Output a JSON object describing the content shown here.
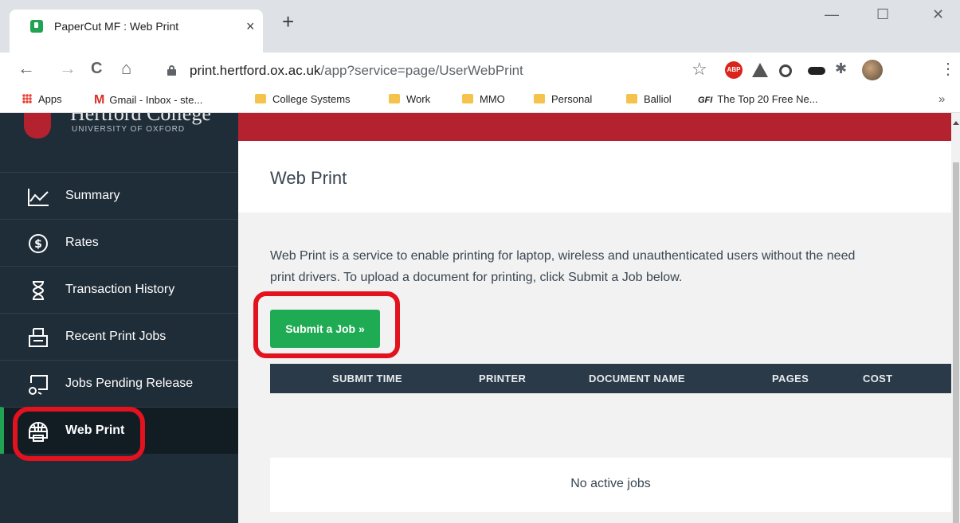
{
  "browser": {
    "tab_title": "PaperCut MF : Web Print",
    "tab_close": "×",
    "new_tab": "+",
    "window_controls": {
      "minimize": "—",
      "maximize": "☐",
      "close": "✕"
    },
    "nav": {
      "back": "←",
      "forward": "→",
      "reload": "C",
      "home": "⌂"
    },
    "url_host": "print.hertford.ox.ac.uk",
    "url_path": "/app?service=page/UserWebPrint",
    "star": "☆",
    "extensions": {
      "abp": "ABP",
      "puzzle": "✱",
      "menu": "⋮"
    },
    "bookmarks": [
      {
        "label": "Apps",
        "icon": "apps-grid-icon"
      },
      {
        "label": "Gmail - Inbox - ste...",
        "icon": "gmail-icon"
      },
      {
        "label": "College Systems",
        "icon": "folder-icon"
      },
      {
        "label": "Work",
        "icon": "folder-icon"
      },
      {
        "label": "MMO",
        "icon": "folder-icon"
      },
      {
        "label": "Personal",
        "icon": "folder-icon"
      },
      {
        "label": "Balliol",
        "icon": "folder-icon"
      },
      {
        "label": "The Top 20 Free Ne...",
        "icon": "gfi-icon"
      }
    ],
    "gmail_mark": "M",
    "gfi_mark": "GFI",
    "bookmarks_more": "»"
  },
  "logo": {
    "name": "Hertford College",
    "subtitle": "UNIVERSITY OF OXFORD"
  },
  "sidebar": {
    "items": [
      {
        "label": "Summary",
        "icon": "chart-line-icon"
      },
      {
        "label": "Rates",
        "icon": "dollar-circle-icon"
      },
      {
        "label": "Transaction History",
        "icon": "hourglass-icon"
      },
      {
        "label": "Recent Print Jobs",
        "icon": "printer-tray-icon"
      },
      {
        "label": "Jobs Pending Release",
        "icon": "pending-release-icon"
      },
      {
        "label": "Web Print",
        "icon": "web-printer-icon",
        "active": true
      }
    ]
  },
  "main": {
    "title": "Web Print",
    "description_line1": "Web Print is a service to enable printing for laptop, wireless and unauthenticated users without the need",
    "description_line2": "print drivers. To upload a document for printing, click Submit a Job below.",
    "submit_label": "Submit a Job »",
    "table_headers": [
      "SUBMIT TIME",
      "PRINTER",
      "DOCUMENT NAME",
      "PAGES",
      "COST"
    ],
    "empty_text": "No active jobs"
  },
  "colors": {
    "sidebar_bg": "#1f2d38",
    "brand_red": "#b5222f",
    "accent_green": "#1fab54",
    "table_header_bg": "#2b3a48",
    "highlight_red": "#e3121f"
  }
}
